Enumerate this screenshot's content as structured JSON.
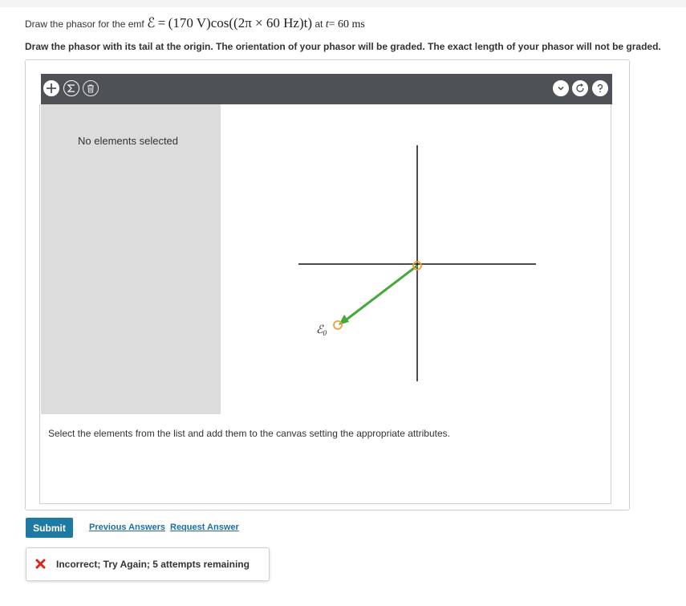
{
  "question": {
    "line1_prefix": "Draw the phasor for the emf",
    "emf_symbol": "ℰ",
    "equals": "=",
    "amplitude": "(170 V)",
    "func": "cos",
    "argument": "((2π × 60 Hz)t)",
    "at_text": "at",
    "t_var": "t",
    "time_value": "= 60 ms",
    "line2": "Draw the phasor with its tail at the origin. The orientation of your phasor will be graded. The exact length of your phasor will not be graded."
  },
  "toolbar": {
    "left_icons": [
      "plus-icon",
      "sigma-icon",
      "trash-icon"
    ],
    "right_icons": [
      "chevron-down-icon",
      "reset-icon",
      "help-icon"
    ]
  },
  "sidebar": {
    "empty_text": "No elements selected"
  },
  "canvas": {
    "vector_label": "ℰ",
    "vector_subscript": "0",
    "vector_color": "#44a83a",
    "handle_color": "#f0a030"
  },
  "instruction": "Select the elements from the list and add them to the canvas setting the appropriate attributes.",
  "actions": {
    "submit": "Submit",
    "previous_answers": "Previous Answers",
    "request_answer": "Request Answer"
  },
  "feedback": {
    "message": "Incorrect; Try Again; 5 attempts remaining",
    "status_color": "#d9261c"
  },
  "colors": {
    "toolbar_bg": "#4e5155",
    "sidebar_bg": "#dcdcdc",
    "submit_bg": "#1f7aa3",
    "link_color": "#1f6e9d"
  }
}
